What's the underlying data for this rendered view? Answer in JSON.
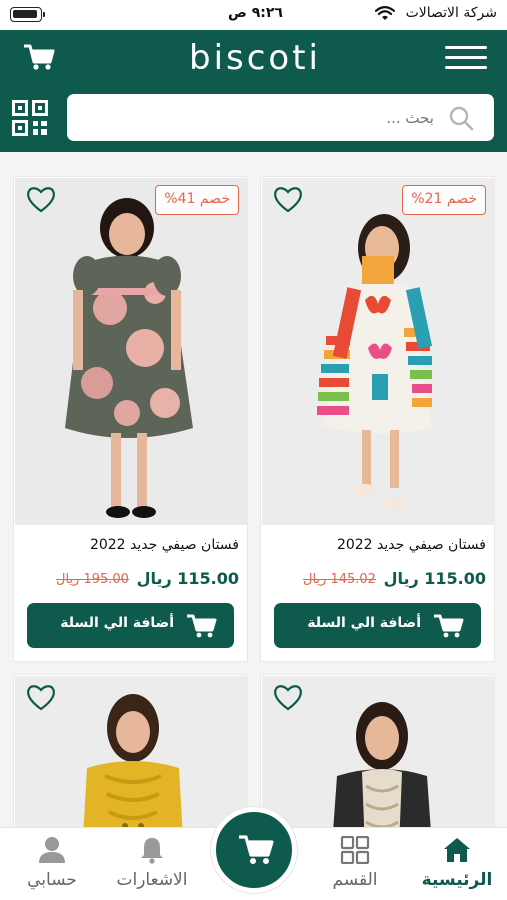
{
  "status_bar": {
    "time": "٩:٢٦ ص",
    "carrier": "شركة الاتصالات"
  },
  "header": {
    "logo": "biscoti",
    "search_placeholder": "بحث ..."
  },
  "products": [
    {
      "title": "فستان صيفي  جديد 2022",
      "price": "115.00 ريال",
      "old_price": "145.02 ريال",
      "discount": "خصم 21%",
      "add_label": "أضافة الي السلة"
    },
    {
      "title": "فستان صيفي  جديد 2022",
      "price": "115.00 ريال",
      "old_price": "195.00 ريال",
      "discount": "خصم 41%",
      "add_label": "أضافة الي السلة"
    },
    {
      "title": "",
      "price": "",
      "old_price": "",
      "discount": "",
      "add_label": ""
    },
    {
      "title": "",
      "price": "",
      "old_price": "",
      "discount": "",
      "add_label": ""
    }
  ],
  "bottom_nav": {
    "home": "الرئيسية",
    "category": "القسم",
    "notifications": "الاشعارات",
    "account": "حسابي"
  },
  "colors": {
    "brand": "#0e5a4c",
    "discount": "#e4664c"
  }
}
